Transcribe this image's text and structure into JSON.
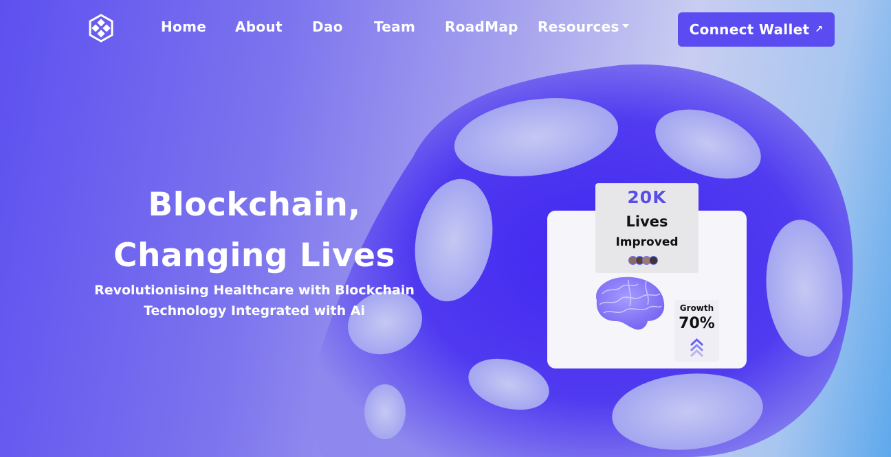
{
  "header": {
    "logo_icon": "hex-cross-logo-icon",
    "nav": [
      {
        "label": "Home"
      },
      {
        "label": "About"
      },
      {
        "label": "Dao"
      },
      {
        "label": "Team"
      },
      {
        "label": "RoadMap"
      },
      {
        "label": "Resources",
        "has_dropdown": true
      }
    ],
    "connect_button": {
      "label": "Connect Wallet",
      "icon": "arrow-up-right-icon"
    }
  },
  "hero": {
    "title_line1": "Blockchain,",
    "title_line2": "Changing Lives",
    "subtitle_line1": "Revolutionising Healthcare with Blockchain",
    "subtitle_line2": "Technology Integrated with Ai"
  },
  "stats_card": {
    "value": "20K",
    "label1": "Lives",
    "label2": "Improved",
    "avatar_count": 4,
    "brain_icon": "brain-icon",
    "growth_label": "Growth",
    "growth_value": "70%",
    "growth_icon": "chevrons-up-icon"
  },
  "colors": {
    "accent": "#5b4cf2",
    "stat_value": "#5a4ee8",
    "card_bg": "#f6f5f9",
    "text_light": "#ffffff"
  }
}
